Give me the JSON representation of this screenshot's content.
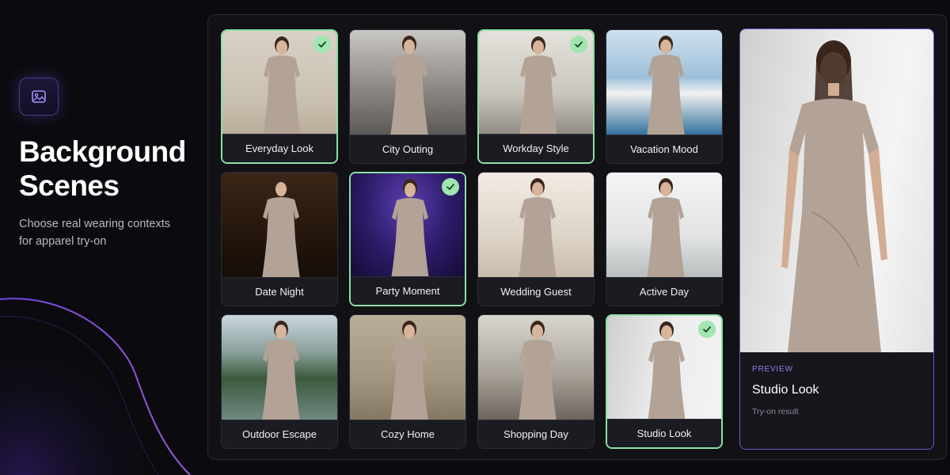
{
  "header": {
    "title_line1": "Background",
    "title_line2": "Scenes",
    "subtitle": "Choose real wearing contexts for apparel try-on",
    "icon": "image-icon"
  },
  "colors": {
    "selected_border": "#8de0a6",
    "check_fill": "#9fe6b0",
    "accent": "#6d55c8",
    "eyebrow": "#8f7de6"
  },
  "scenes": [
    {
      "label": "Everyday Look",
      "selected": true,
      "bg": "linear-gradient(180deg,#d9d2c6,#c8bfae 70%,#b9ad98)"
    },
    {
      "label": "City Outing",
      "selected": false,
      "bg": "linear-gradient(180deg,#c9c7c3,#8d8883 55%,#5a5856)"
    },
    {
      "label": "Workday Style",
      "selected": true,
      "bg": "linear-gradient(180deg,#e4e2dc,#c9c6bd 60%,#8f8b83)"
    },
    {
      "label": "Vacation Mood",
      "selected": false,
      "bg": "linear-gradient(180deg,#cfe0ee 0%,#9dc0da 45%,#f2f2f0 60%,#2f6f9c 100%)"
    },
    {
      "label": "Date Night",
      "selected": false,
      "bg": "linear-gradient(180deg,#3a2616,#24160c 60%,#150d07)"
    },
    {
      "label": "Party Moment",
      "selected": true,
      "bg": "radial-gradient(ellipse at 50% 30%,#5b3fb0,#2c1a66 55%,#140b33)"
    },
    {
      "label": "Wedding Guest",
      "selected": false,
      "bg": "linear-gradient(180deg,#f1ebe3,#ddd4c7 60%,#c8bcab)"
    },
    {
      "label": "Active Day",
      "selected": false,
      "bg": "linear-gradient(180deg,#f3f4f4,#e2e4e4 60%,#b9bcbd)"
    },
    {
      "label": "Outdoor Escape",
      "selected": false,
      "bg": "linear-gradient(180deg,#c9d6dd 0%,#8aa19c 35%,#3c5a3c 60%,#6f8a82 100%)"
    },
    {
      "label": "Cozy Home",
      "selected": false,
      "bg": "linear-gradient(180deg,#b9ad98,#a39680 60%,#847862)"
    },
    {
      "label": "Shopping Day",
      "selected": false,
      "bg": "linear-gradient(180deg,#d9d6d0,#a9a39a 55%,#6b655d)"
    },
    {
      "label": "Studio Look",
      "selected": true,
      "bg": "linear-gradient(100deg,#cfcfcf,#ececec 50%,#f3f3f3)"
    }
  ],
  "preview": {
    "eyebrow": "PREVIEW",
    "title": "Studio Look",
    "subtitle": "Try-on result"
  }
}
